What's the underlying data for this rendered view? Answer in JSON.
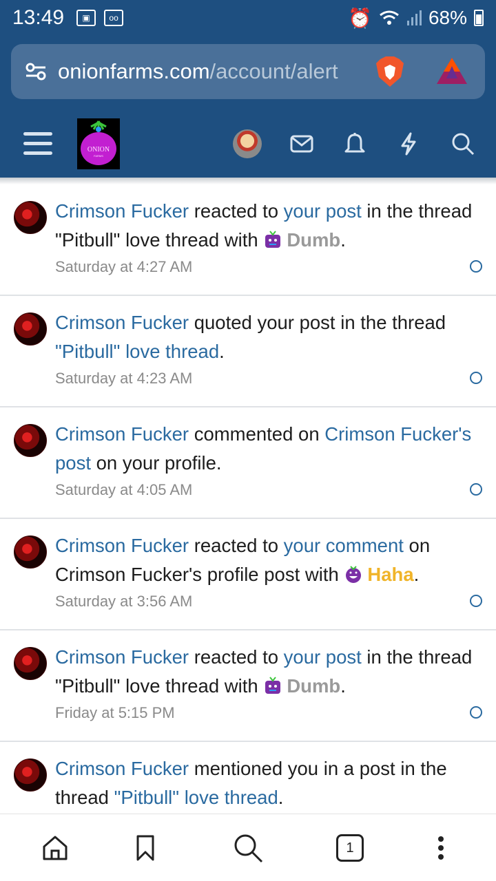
{
  "status": {
    "time": "13:49",
    "battery": "68%"
  },
  "browser": {
    "url_host": "onionfarms.com",
    "url_path": "/account/alert"
  },
  "site": {
    "logo_text": "ONION",
    "logo_sub": "FARMS"
  },
  "alerts": [
    {
      "user": "Crimson Fucker",
      "parts": [
        " reacted to ",
        "your post",
        " in the thread \"Pitbull\" love thread with ",
        "Dumb",
        "."
      ],
      "time": "Saturday at 4:27 AM"
    },
    {
      "user": "Crimson Fucker",
      "parts": [
        " quoted your post in the thread ",
        "\"Pitbull\" love thread",
        "."
      ],
      "time": "Saturday at 4:23 AM"
    },
    {
      "user": "Crimson Fucker",
      "parts": [
        " commented on ",
        "Crimson Fucker's post",
        " on your profile."
      ],
      "time": "Saturday at 4:05 AM"
    },
    {
      "user": "Crimson Fucker",
      "parts": [
        " reacted to ",
        "your comment",
        " on Crimson Fucker's profile post with ",
        "Haha",
        "."
      ],
      "time": "Saturday at 3:56 AM"
    },
    {
      "user": "Crimson Fucker",
      "parts": [
        " reacted to ",
        "your post",
        " in the thread \"Pitbull\" love thread with ",
        "Dumb",
        "."
      ],
      "time": "Friday at 5:15 PM"
    },
    {
      "user": "Crimson Fucker",
      "parts": [
        " mentioned you in a post in the thread ",
        "\"Pitbull\" love thread",
        "."
      ],
      "time": ""
    }
  ],
  "bottom_nav": {
    "tab_count": "1"
  },
  "colors": {
    "header": "#1e4f80",
    "link": "#2a6aa0",
    "dumb": "#9a9a9a",
    "haha": "#f0b429"
  },
  "icons": [
    "menu-icon",
    "mail-icon",
    "bell-icon",
    "bolt-icon",
    "search-icon",
    "home-icon",
    "bookmark-icon",
    "more-icon"
  ]
}
